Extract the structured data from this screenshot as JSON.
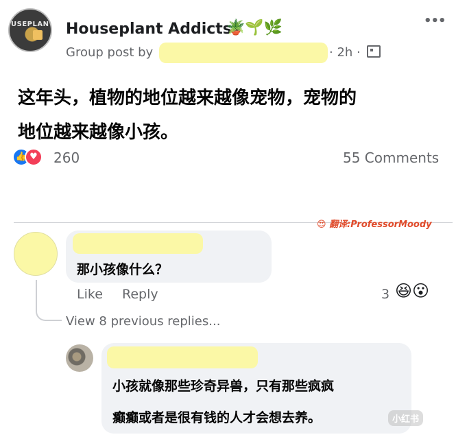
{
  "header": {
    "group_name": "Houseplant Addicts",
    "group_emojis": "🪴🌱🌿",
    "avatar_text": "USEPLANT",
    "post_by_label": "Group post by",
    "time": "· 2h ·",
    "more": "•••"
  },
  "post": {
    "text_line1": "这年头，植物的地位越来越像宠物，宠物的",
    "text_line2": "地位越来越像小孩。"
  },
  "stats": {
    "reaction_count": "260",
    "comments": "55 Comments",
    "like_icon": "👍",
    "love_icon": "♥"
  },
  "credit": {
    "emoji": "😍",
    "text": "翻译:ProfessorMoody"
  },
  "comment1": {
    "text": "那小孩像什么？",
    "like_label": "Like",
    "reply_label": "Reply",
    "reaction_count": "3",
    "reaction_emojis": "😆😮"
  },
  "view_replies": "View 8 previous replies...",
  "comment2": {
    "line1": "小孩就像那些珍奇异兽，只有那些疯疯",
    "line2": "癫癫或者是很有钱的人才会想去养。"
  },
  "watermark": "小红书",
  "colors": {
    "highlight_blur": "#fbf8a6",
    "bubble": "#f0f2f5",
    "secondary_text": "#65676b",
    "like_blue": "#1877f2",
    "love_red": "#f33e58"
  }
}
